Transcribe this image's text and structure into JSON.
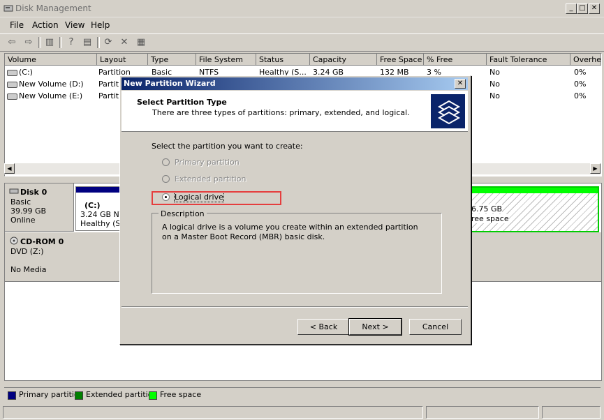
{
  "window": {
    "title": "Disk Management"
  },
  "menu": {
    "items": [
      "File",
      "Action",
      "View",
      "Help"
    ]
  },
  "toolbar": {
    "icons": [
      "back-arrow-icon",
      "forward-arrow-icon",
      "console-tree-icon",
      "help-icon",
      "properties-icon",
      "refresh-icon",
      "delete-icon",
      "rescan-icon"
    ]
  },
  "volume_list": {
    "columns": [
      "Volume",
      "Layout",
      "Type",
      "File System",
      "Status",
      "Capacity",
      "Free Space",
      "% Free",
      "Fault Tolerance",
      "Overhe"
    ],
    "rows": [
      {
        "volume": "(C:)",
        "layout": "Partition",
        "type": "Basic",
        "fs": "NTFS",
        "status": "Healthy (S...",
        "capacity": "3.24 GB",
        "free": "132 MB",
        "pct": "3 %",
        "fault": "No",
        "overhead": "0%"
      },
      {
        "volume": "New Volume (D:)",
        "layout": "Partiti",
        "fault": "No",
        "overhead": "0%"
      },
      {
        "volume": "New Volume (E:)",
        "layout": "Partiti",
        "fault": "No",
        "overhead": "0%"
      }
    ]
  },
  "disks": {
    "disk0": {
      "name": "Disk 0",
      "type": "Basic",
      "size": "39.99 GB",
      "state": "Online",
      "partition_c": {
        "label": "(C:)",
        "size": "3.24 GB NTI",
        "status": "Healthy (Sy"
      },
      "free_part": {
        "size": "6.75 GB",
        "status": "ree space"
      }
    },
    "cdrom0": {
      "name": "CD-ROM 0",
      "type": "DVD (Z:)",
      "state": "No Media"
    }
  },
  "legend": {
    "items": [
      {
        "label": "Primary partition",
        "color": "#000080"
      },
      {
        "label": "Extended partition",
        "color": "#008000"
      },
      {
        "label": "Free space",
        "color": "#00ff00"
      }
    ]
  },
  "wizard": {
    "title": "New Partition Wizard",
    "heading": "Select Partition Type",
    "subheading": "There are three types of partitions: primary, extended, and logical.",
    "prompt": "Select the partition you want to create:",
    "options": [
      {
        "label": "Primary partition",
        "enabled": false,
        "selected": false
      },
      {
        "label": "Extended partition",
        "enabled": false,
        "selected": false
      },
      {
        "label": "Logical drive",
        "enabled": true,
        "selected": true
      }
    ],
    "description_label": "Description",
    "description": "A logical drive is a volume you create within an extended partition on a Master Boot Record (MBR) basic disk.",
    "buttons": {
      "back": "< Back",
      "next": "Next >",
      "cancel": "Cancel"
    }
  }
}
